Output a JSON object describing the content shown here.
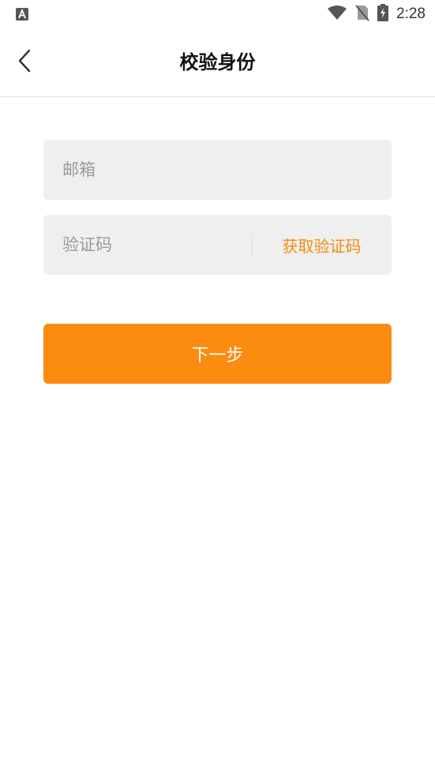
{
  "status_bar": {
    "time": "2:28",
    "icons": [
      "text-a-icon",
      "wifi-icon",
      "no-sim-icon",
      "battery-charging-icon"
    ]
  },
  "header": {
    "title": "校验身份",
    "back_icon": "chevron-left-icon"
  },
  "form": {
    "email": {
      "placeholder": "邮箱",
      "value": ""
    },
    "code": {
      "placeholder": "验证码",
      "value": ""
    },
    "get_code_label": "获取验证码",
    "next_label": "下一步"
  },
  "colors": {
    "accent": "#fc8c11",
    "accent_text": "#f28b0c",
    "field_bg": "#efefef",
    "placeholder": "#9a9a9a"
  }
}
